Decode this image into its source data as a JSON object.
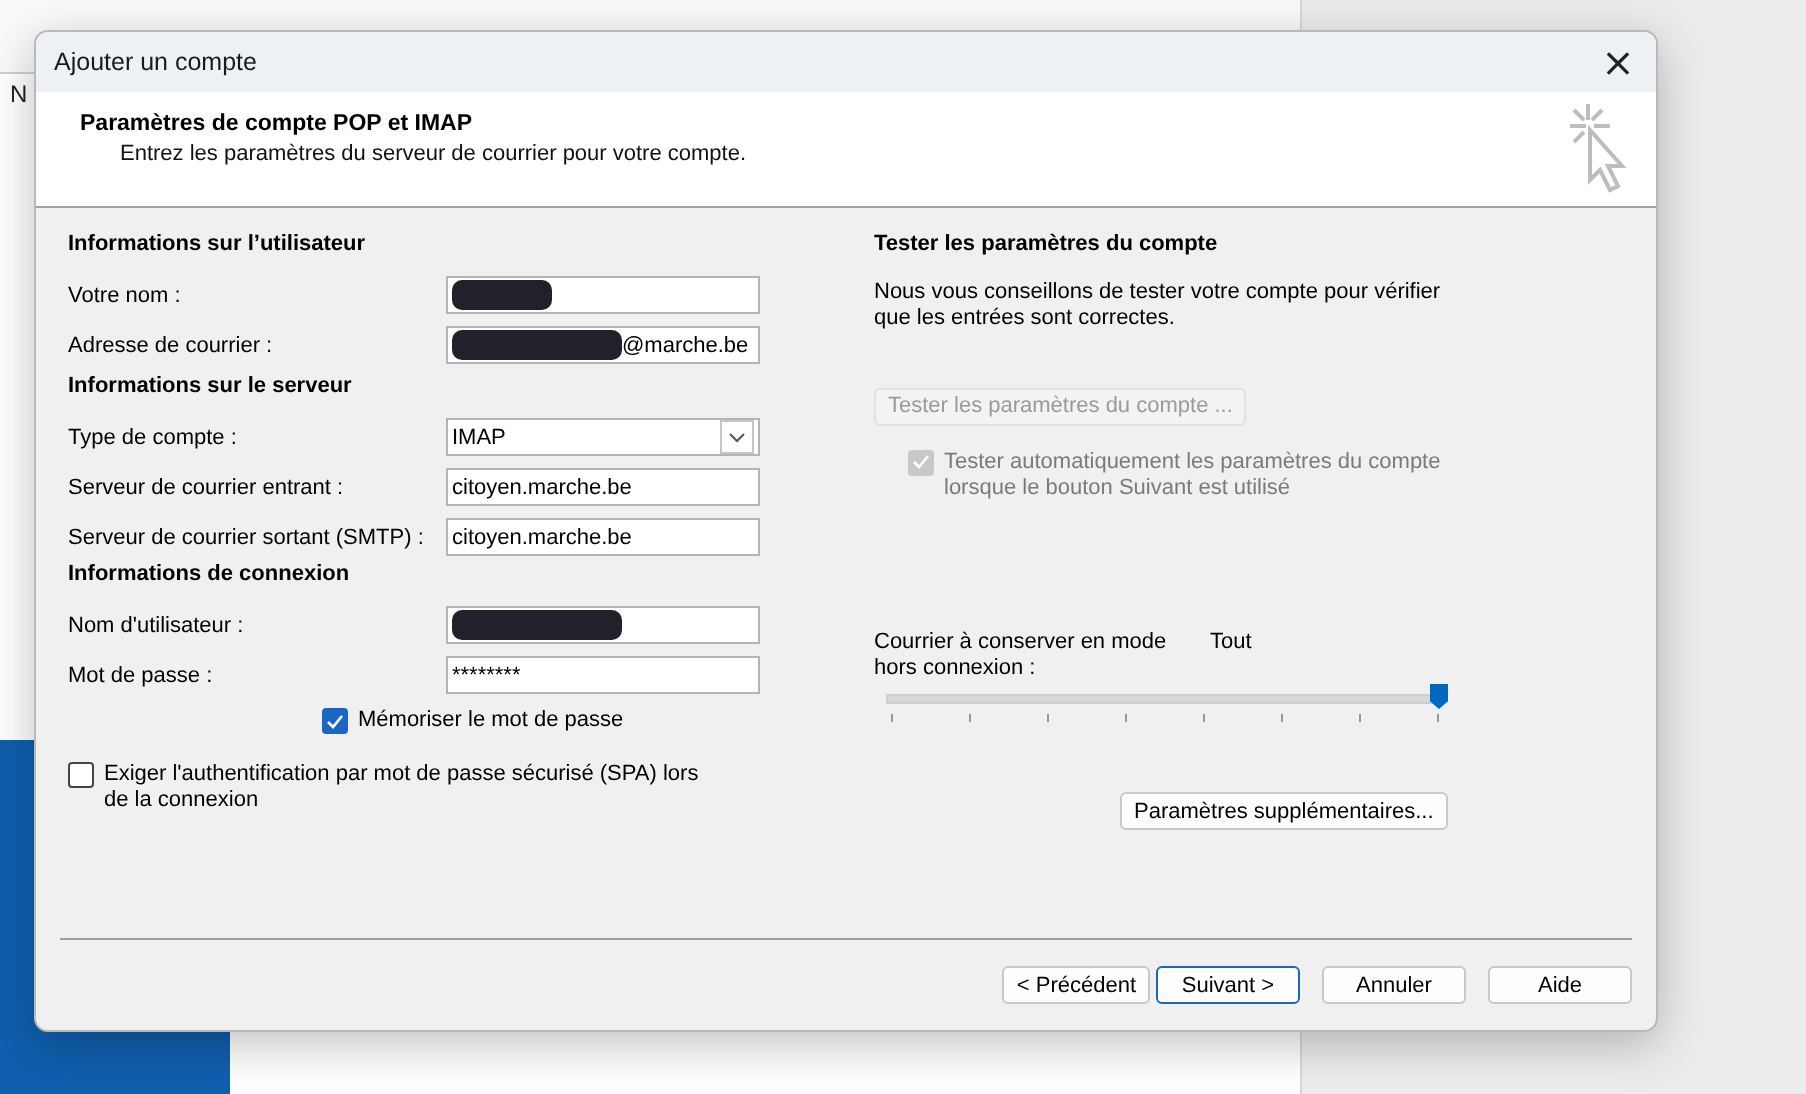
{
  "background_app": {
    "texts": [
      "N"
    ]
  },
  "window": {
    "title": "Ajouter un compte",
    "close": "×"
  },
  "header": {
    "title": "Paramètres de compte POP et IMAP",
    "subtitle": "Entrez les paramètres du serveur de courrier pour votre compte."
  },
  "sections": [
    {
      "title": "Informations sur l’utilisateur",
      "rows": [
        {
          "label": "Votre nom :",
          "kind": "text",
          "redacted": true
        },
        {
          "label": "Adresse de courrier :",
          "kind": "text",
          "redacted": true,
          "value": "@marche.be"
        }
      ]
    },
    {
      "title": "Informations sur le serveur",
      "rows": [
        {
          "label": "Type de compte :",
          "kind": "select",
          "value": "IMAP"
        },
        {
          "label": "Serveur de courrier entrant :",
          "kind": "text",
          "redacted": false,
          "value": "citoyen.marche.be"
        },
        {
          "label": "Serveur de courrier sortant (SMTP) :",
          "kind": "text",
          "redacted": false,
          "value": "citoyen.marche.be"
        }
      ]
    },
    {
      "title": "Informations de connexion",
      "rows": [
        {
          "label": "Nom d'utilisateur :",
          "kind": "text",
          "redacted": true
        },
        {
          "label": "Mot de passe :",
          "kind": "text",
          "redacted": false,
          "value": "********"
        }
      ]
    }
  ],
  "remember_password": {
    "label": "Mémoriser le mot de passe",
    "checked": true
  },
  "spa": {
    "label": "Exiger l'authentification par mot de passe sécurisé (SPA) lors de la connexion",
    "checked": false
  },
  "test": {
    "title": "Tester les paramètres du compte",
    "text": "Nous vous conseillons de tester votre compte pour vérifier que les entrées sont correctes.",
    "button": "Tester les paramètres du compte ...",
    "button_disabled": true,
    "auto": {
      "label": "Tester automatiquement les paramètres du compte lorsque le bouton Suivant est utilisé",
      "checked": true,
      "disabled": true
    }
  },
  "offline": {
    "label": "Courrier à conserver en mode hors connexion :",
    "reading": "Tout",
    "level": 1
  },
  "more_settings": "Paramètres supplémentaires...",
  "buttons": [
    {
      "label": "< Précédent",
      "default": false
    },
    {
      "label": "Suivant >",
      "default": true
    },
    {
      "label": "Annuler",
      "default": false
    },
    {
      "label": "Aide",
      "default": false
    }
  ]
}
